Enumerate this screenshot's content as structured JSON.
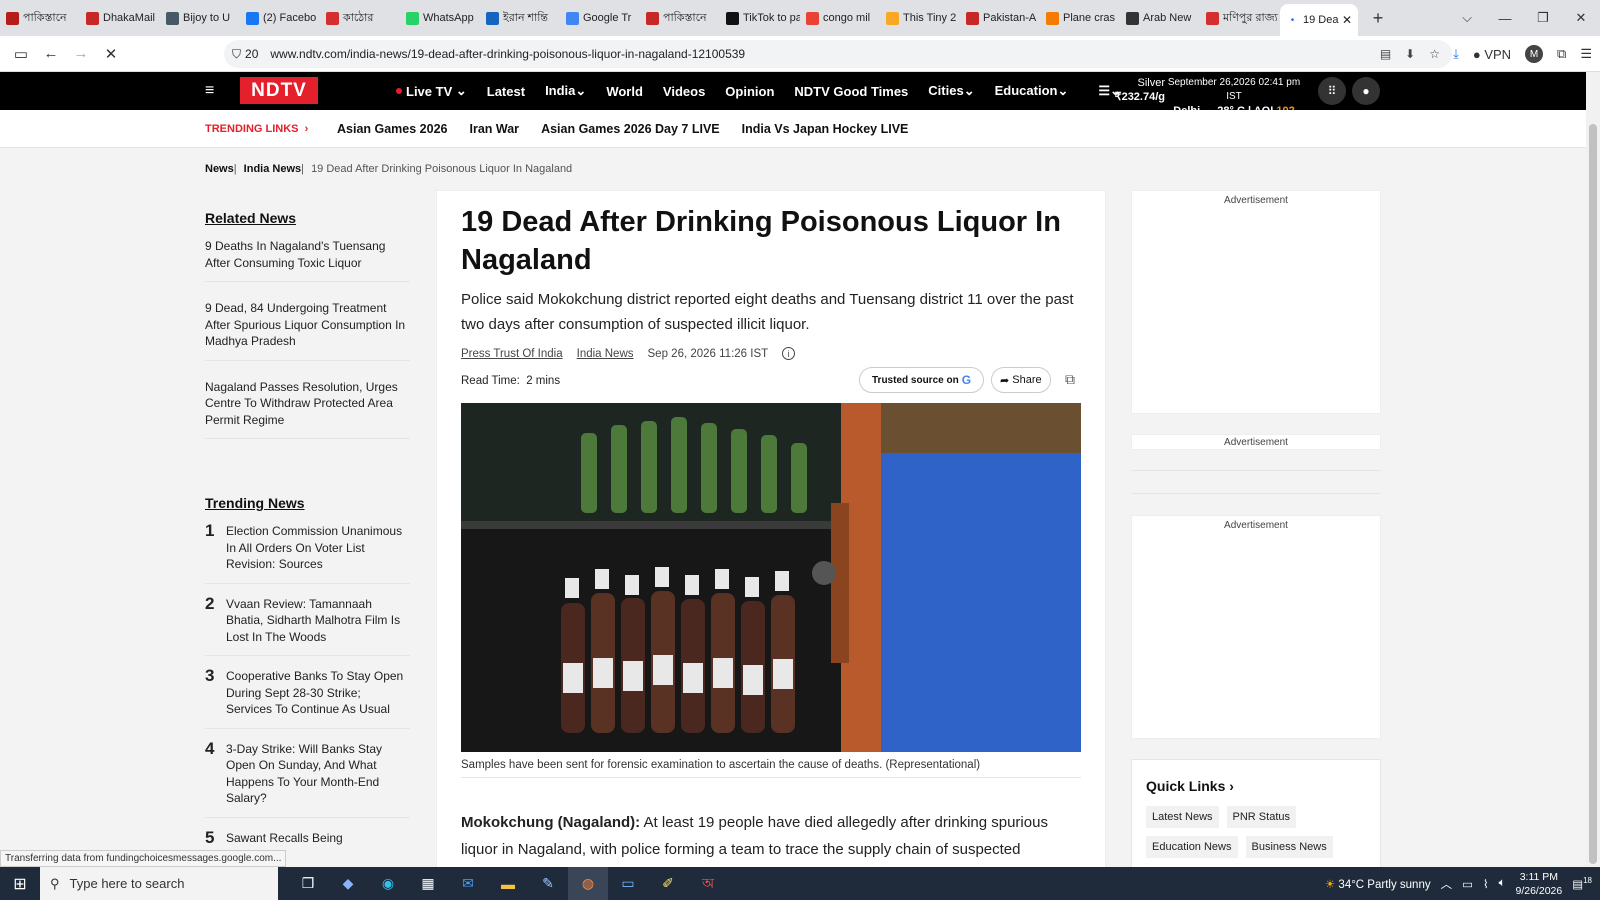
{
  "browser": {
    "tabs": [
      {
        "label": "পাকিস্তানে",
        "color": "#b71c1c"
      },
      {
        "label": "DhakaMail",
        "color": "#c62828"
      },
      {
        "label": "Bijoy to U",
        "color": "#455a64"
      },
      {
        "label": "(2) Facebo",
        "color": "#1877f2"
      },
      {
        "label": "কাঠোর",
        "color": "#d32f2f"
      },
      {
        "label": "WhatsApp",
        "color": "#25d366"
      },
      {
        "label": "ইরান শান্তি",
        "color": "#1565c0"
      },
      {
        "label": "Google Tr",
        "color": "#4285f4"
      },
      {
        "label": "পাকিস্তানে",
        "color": "#c62828"
      },
      {
        "label": "TikTok to pay",
        "color": "#111111"
      },
      {
        "label": "congo mil",
        "color": "#ea4335"
      },
      {
        "label": "This Tiny 2",
        "color": "#f9a825"
      },
      {
        "label": "Pakistan-A",
        "color": "#c62828"
      },
      {
        "label": "Plane cras",
        "color": "#f57c00"
      },
      {
        "label": "Arab New",
        "color": "#333333"
      },
      {
        "label": "মণিপুর রাজ্য",
        "color": "#d32f2f"
      }
    ],
    "active_tab": "19 Dea",
    "new_tab_icon": "+",
    "address": {
      "tracker_count": "20",
      "url": "www.ndtv.com/india-news/19-dead-after-drinking-poisonous-liquor-in-nagaland-12100539"
    },
    "vpn_label": "VPN",
    "profile_initial": "M"
  },
  "header": {
    "logo": "NDTV",
    "nav": [
      "Live TV",
      "Latest",
      "India",
      "World",
      "Videos",
      "Opinion",
      "NDTV Good Times",
      "Cities",
      "Education"
    ],
    "silver_label": "Silver",
    "silver_value": "₹232.74/g",
    "date": "September 26,2026 02:41 pm IST",
    "city": "Delhi",
    "temp": "28° C",
    "aqi_label": "AQI",
    "aqi_value": "102"
  },
  "trending": {
    "label": "TRENDING LINKS",
    "links": [
      "Asian Games 2026",
      "Iran War",
      "Asian Games 2026 Day 7 LIVE",
      "India Vs Japan Hockey LIVE"
    ]
  },
  "breadcrumb": [
    "News",
    "India News",
    "19 Dead After Drinking Poisonous Liquor In Nagaland"
  ],
  "related": {
    "title": "Related News",
    "items": [
      "9 Deaths In Nagaland's Tuensang After Consuming Toxic Liquor",
      "9 Dead, 84 Undergoing Treatment After Spurious Liquor Consumption In Madhya Pradesh",
      "Nagaland Passes Resolution, Urges Centre To Withdraw Protected Area Permit Regime"
    ]
  },
  "trending_news": {
    "title": "Trending News",
    "items": [
      {
        "n": "1",
        "text": "Election Commission Unanimous In All Orders On Voter List Revision: Sources"
      },
      {
        "n": "2",
        "text": "Vvaan Review: Tamannaah Bhatia, Sidharth Malhotra Film Is Lost In The Woods"
      },
      {
        "n": "3",
        "text": "Cooperative Banks To Stay Open During Sept 28-30 Strike; Services To Continue As Usual"
      },
      {
        "n": "4",
        "text": "3-Day Strike: Will Banks Stay Open On Sunday, And What Happens To Your Month-End Salary?"
      },
      {
        "n": "5",
        "text": "Sawant Recalls Being"
      }
    ]
  },
  "article": {
    "headline": "19 Dead After Drinking Poisonous Liquor In Nagaland",
    "dek": "Police said Mokokchung district reported eight deaths and Tuensang district 11 over the past two days after consumption of suspected illicit liquor.",
    "author": "Press Trust Of India",
    "category": "India News",
    "timestamp": "Sep 26, 2026 11:26 IST",
    "read_time_label": "Read Time:",
    "read_time": "2 mins",
    "trusted_label": "Trusted source on",
    "share_label": "Share",
    "caption": "Samples have been sent for forensic examination to ascertain the cause of deaths. (Representational)",
    "dateline": "Mokokchung (Nagaland):",
    "body": "At least 19 people have died allegedly after drinking spurious liquor in Nagaland, with police forming a team to trace the supply chain of suspected"
  },
  "ads": {
    "label": "Advertisement"
  },
  "quick_links": {
    "title": "Quick Links",
    "items": [
      "Latest News",
      "PNR Status",
      "Education News",
      "Business News"
    ]
  },
  "status_bar": "Transferring data from fundingchoicesmessages.google.com...",
  "taskbar": {
    "search_placeholder": "Type here to search",
    "weather": "34°C  Partly sunny",
    "time": "3:11 PM",
    "date": "9/26/2026",
    "notifications": "18"
  }
}
